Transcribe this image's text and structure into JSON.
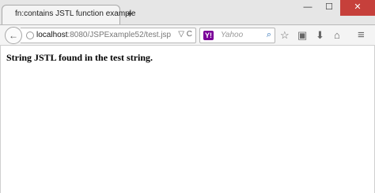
{
  "tab": {
    "title": "fn:contains JSTL function example",
    "new_tab": "+"
  },
  "window": {
    "minimize": "—",
    "maximize": "☐",
    "close": "✕"
  },
  "navigation": {
    "back": "←",
    "url_host": "localhost",
    "url_path": ":8080/JSPExample52/test.jsp",
    "dropdown": "▽",
    "reload": "C"
  },
  "search": {
    "engine": "Y!",
    "placeholder": "Yahoo",
    "go": "⌕"
  },
  "toolbar": {
    "bookmark": "☆",
    "clipboard": "▣",
    "download": "⬇",
    "home": "⌂",
    "menu": "≡"
  },
  "page": {
    "message": "String JSTL found in the test string."
  }
}
